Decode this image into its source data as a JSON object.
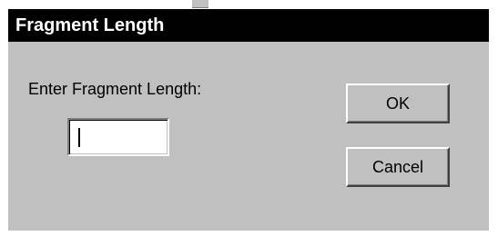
{
  "dialog": {
    "title": "Fragment Length",
    "prompt": "Enter Fragment Length:",
    "input": {
      "value": ""
    },
    "buttons": {
      "ok_label": "OK",
      "cancel_label": "Cancel"
    }
  },
  "colors": {
    "titlebar_bg": "#000000",
    "titlebar_text": "#ffffff",
    "dialog_bg": "#c0c0c0"
  }
}
